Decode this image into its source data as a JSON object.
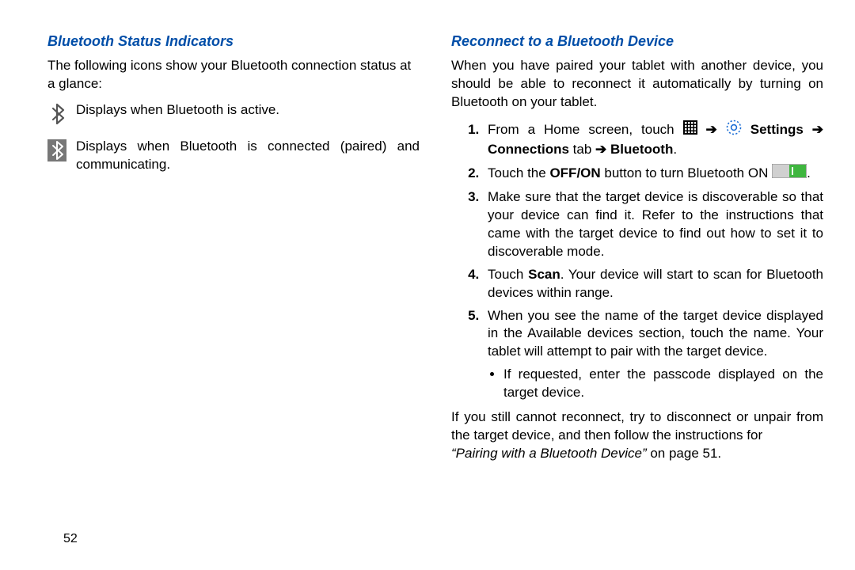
{
  "left": {
    "heading": "Bluetooth Status Indicators",
    "intro": "The following icons show your Bluetooth connection status at a glance:",
    "rows": [
      "Displays when Bluetooth is active.",
      "Displays when Bluetooth is connected (paired) and communicating."
    ]
  },
  "right": {
    "heading": "Reconnect to a Bluetooth Device",
    "intro": "When you have paired your tablet with another device, you should be able to reconnect it automatically by turning on Bluetooth on your tablet.",
    "step1_prefix": "From a Home screen, touch ",
    "settings_label": "Settings",
    "connections_tab_label": "Connections",
    "tab_word": " tab ",
    "bluetooth_label": "Bluetooth",
    "step2_pre": "Touch the ",
    "step2_btn": "OFF/ON",
    "step2_post": " button to turn Bluetooth ON ",
    "step3": "Make sure that the target device is discoverable so that your device can find it. Refer to the instructions that came with the target device to find out how to set it to discoverable mode.",
    "step4_pre": "Touch ",
    "step4_bold": "Scan",
    "step4_post": ". Your device will start to scan for Bluetooth devices within range.",
    "step5": "When you see the name of the target device displayed in the Available devices section, touch the name. Your tablet will attempt to pair with the target device.",
    "sub1": "If requested, enter the passcode displayed on the target device.",
    "outro_text": "If you still cannot reconnect, try to disconnect or unpair from the target device, and then follow the instructions for ",
    "outro_ref": "“Pairing with a Bluetooth Device”",
    "outro_page": " on page 51."
  },
  "arrow_glyph": "➔",
  "page_number": "52"
}
